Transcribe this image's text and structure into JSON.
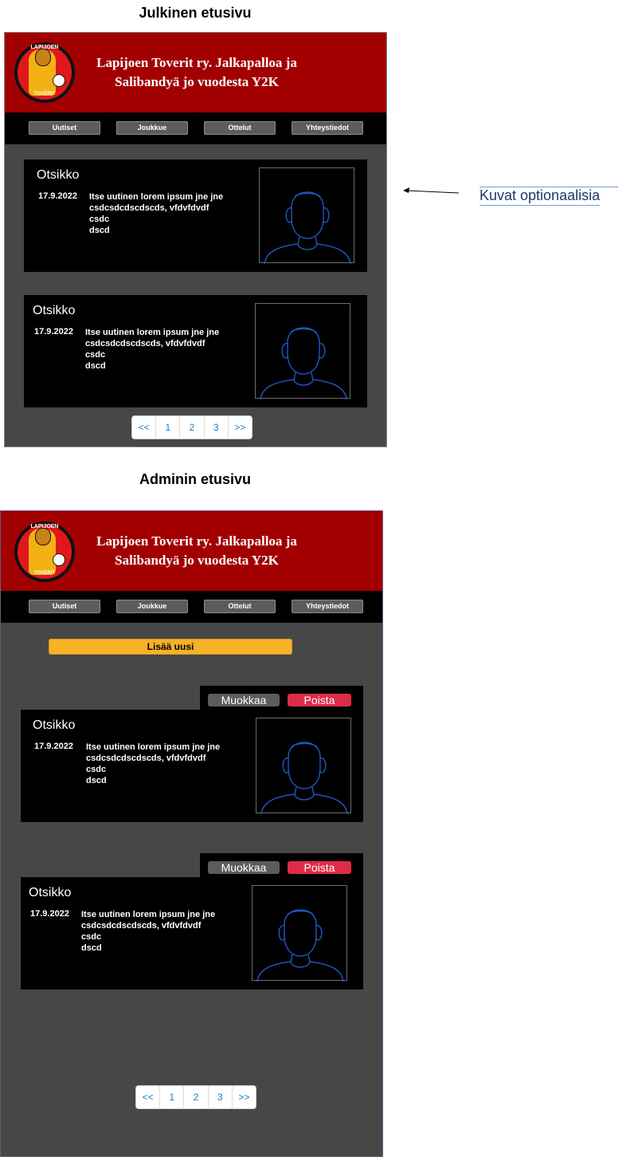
{
  "public_page": {
    "section_title": "Julkinen etusivu",
    "site_title": "Lapijoen Toverit ry. Jalkapalloa ja Salibandyä jo vuodesta Y2K",
    "logo": {
      "text_top": "LAPIJOEN",
      "text_bottom": "TOVERIT"
    },
    "nav": [
      "Uutiset",
      "Joukkue",
      "Ottelut",
      "Yhteystiedot"
    ],
    "news": [
      {
        "title": "Otsikko",
        "date": "17.9.2022",
        "body": "Itse uutinen lorem ipsum jne jne\ncsdcsdcdscdscds, vfdvfdvdf\ncsdc\ndscd",
        "image": "person-placeholder-icon"
      },
      {
        "title": "Otsikko",
        "date": "17.9.2022",
        "body": "Itse uutinen lorem ipsum jne jne\ncsdcsdcdscdscds, vfdvfdvdf\ncsdc\ndscd",
        "image": "person-placeholder-icon"
      }
    ],
    "pagination": [
      "<<",
      "1",
      "2",
      "3",
      ">>"
    ]
  },
  "admin_page": {
    "section_title": "Adminin etusivu",
    "site_title": "Lapijoen Toverit ry. Jalkapalloa ja Salibandyä jo vuodesta Y2K",
    "logo": {
      "text_top": "LAPIJOEN",
      "text_bottom": "TOVERIT"
    },
    "nav": [
      "Uutiset",
      "Joukkue",
      "Ottelut",
      "Yhteystiedot"
    ],
    "add_new_label": "Lisää uusi",
    "edit_label": "Muokkaa",
    "delete_label": "Poista",
    "news": [
      {
        "title": "Otsikko",
        "date": "17.9.2022",
        "body": "Itse uutinen lorem ipsum jne jne\ncsdcsdcdscdscds, vfdvfdvdf\ncsdc\ndscd",
        "image": "person-placeholder-icon"
      },
      {
        "title": "Otsikko",
        "date": "17.9.2022",
        "body": "Itse uutinen lorem ipsum jne jne\ncsdcsdcdscdscds, vfdvfdvdf\ncsdc\ndscd",
        "image": "person-placeholder-icon"
      }
    ],
    "pagination": [
      "<<",
      "1",
      "2",
      "3",
      ">>"
    ]
  },
  "annotation": {
    "label": "Kuvat  optionaalisia",
    "pointer": "arrow-left-icon"
  },
  "colors": {
    "header_red": "#a20000",
    "frame_gray": "#474747",
    "nav_button": "#5c5c5c",
    "add_button": "#f7b228",
    "delete_button": "#de2c48",
    "pager_link": "#1a7bbf"
  }
}
